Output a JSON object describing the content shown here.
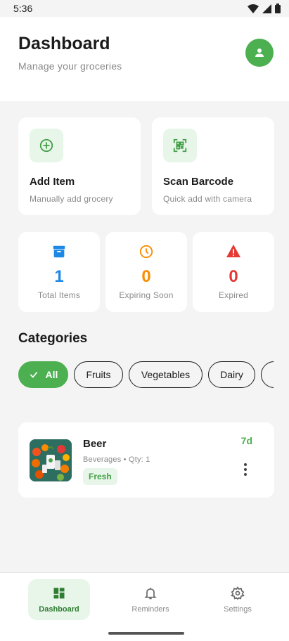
{
  "status_bar": {
    "time": "5:36",
    "icons": [
      "wifi-icon",
      "cellular-signal-icon",
      "battery-icon"
    ]
  },
  "header": {
    "title": "Dashboard",
    "subtitle": "Manage your groceries",
    "avatar_icon": "person-icon"
  },
  "actions": [
    {
      "title": "Add Item",
      "subtitle": "Manually add grocery",
      "icon": "add-circle-icon"
    },
    {
      "title": "Scan Barcode",
      "subtitle": "Quick add with camera",
      "icon": "barcode-scan-icon"
    }
  ],
  "stats": [
    {
      "value": "1",
      "label": "Total Items",
      "color": "#1e88e5",
      "icon": "archive-box-icon"
    },
    {
      "value": "0",
      "label": "Expiring Soon",
      "color": "#fb8c00",
      "icon": "clock-icon"
    },
    {
      "value": "0",
      "label": "Expired",
      "color": "#e53935",
      "icon": "warning-icon"
    }
  ],
  "categories": {
    "title": "Categories",
    "chips": [
      "All",
      "Fruits",
      "Vegetables",
      "Dairy"
    ],
    "selected": "All"
  },
  "items": [
    {
      "name": "Beer",
      "meta": "Beverages • Qty: 1",
      "status": "Fresh",
      "days_left": "7d"
    }
  ],
  "nav": {
    "items": [
      {
        "label": "Dashboard",
        "icon": "dashboard-icon",
        "active": true
      },
      {
        "label": "Reminders",
        "icon": "bell-icon",
        "active": false
      },
      {
        "label": "Settings",
        "icon": "gear-icon",
        "active": false
      }
    ]
  },
  "colors": {
    "accent": "#4caf50",
    "accent_light": "#e8f5e9",
    "background": "#f4f4f4"
  }
}
